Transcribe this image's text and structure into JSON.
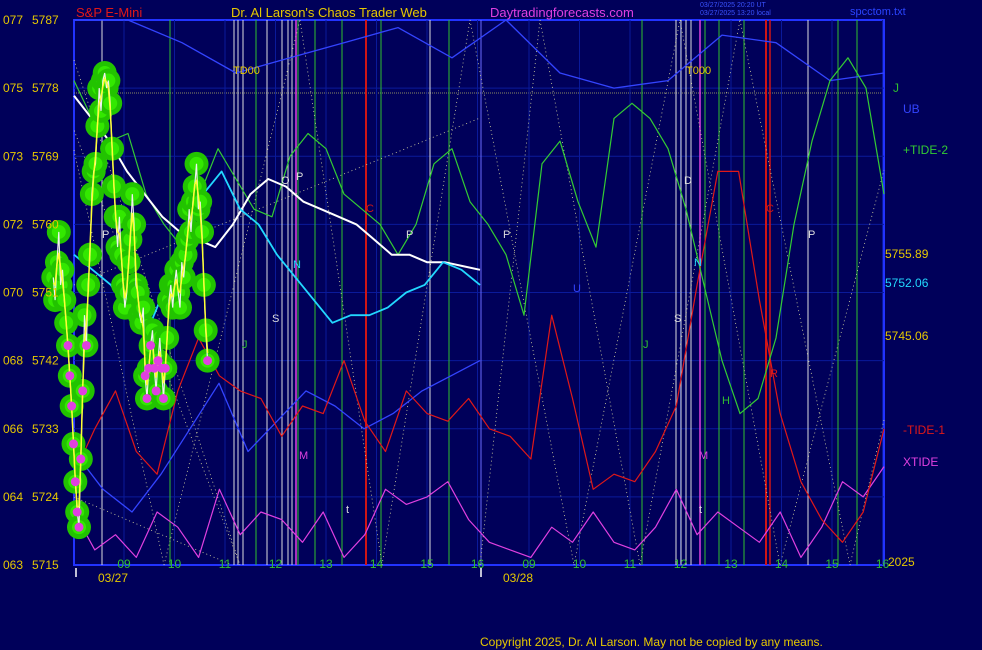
{
  "header": {
    "instrument": "S&P E-Mini",
    "author": "Dr. Al Larson's Chaos Trader Web",
    "site": "Daytradingforecasts.com",
    "time_line_1": "03/27/2025 20:20 UT",
    "time_line_2": "03/27/2025 13:20 local",
    "file": "spcctom.txt"
  },
  "footer": {
    "copyright": "Copyright 2025, Dr. Al Larson. May not be copied by any means."
  },
  "colors": {
    "background": "#00005a",
    "frame": "#2233ff",
    "grid": "#0a1a9a",
    "price": "#f0f0f0",
    "label_gold": "#e6c800",
    "tide2": "#33cc33",
    "tide1": "#e01818",
    "xtide": "#e040e0",
    "band": "#3344ff",
    "white_ma": "#ffffff",
    "cyan_ma": "#22d8ff",
    "yellow_ma": "#ffff33",
    "halo": "#22c300",
    "red_line": "#d01515",
    "green_line": "#2fbf2f",
    "gray_line": "#dddddd"
  },
  "chart_data": {
    "type": "line",
    "title": "S&P E-Mini",
    "y_left_codes": [
      "077",
      "075",
      "073",
      "072",
      "070",
      "068",
      "066",
      "064",
      "063"
    ],
    "y_left_prices": [
      "5787",
      "5778",
      "5769",
      "5760",
      "5751",
      "5742",
      "5733",
      "5724",
      "5715"
    ],
    "ylim": [
      5715,
      5787
    ],
    "x_hour_labels": [
      "09",
      "10",
      "11",
      "12",
      "13",
      "14",
      "15",
      "16",
      "09",
      "10",
      "11",
      "12",
      "13",
      "14",
      "15",
      "16"
    ],
    "date_labels": [
      "03/27",
      "03/28"
    ],
    "year_label": "2025",
    "x": [
      0,
      0.0364,
      0.0727,
      0.109,
      0.145,
      0.182,
      0.218,
      0.255,
      0.291,
      0.327,
      0.364,
      0.4,
      0.436,
      0.473,
      0.509,
      0.545,
      0.582,
      0.618,
      0.655,
      0.691,
      0.727,
      0.764,
      0.8,
      0.836,
      0.873,
      0.909,
      0.945,
      0.982,
      1.018,
      1.055,
      1.091,
      1.127,
      1.164,
      1.2,
      1.236,
      1.273,
      1.309,
      1.345,
      1.382,
      1.418,
      1.455,
      1.491,
      1.527,
      1.564,
      1.6,
      1.636,
      1.673,
      1.709,
      1.745,
      1.782,
      1.818,
      1.855,
      1.891,
      1.927,
      1.964,
      2,
      2.036,
      2.073,
      2.109,
      2.145,
      2.182,
      2.218,
      2.255,
      2.291,
      2.327,
      2.364,
      2.4,
      2.436,
      2.473,
      2.509,
      2.545,
      2.582,
      2.618,
      2.655,
      2.691,
      2.727,
      2.764,
      2.8,
      2.836,
      2.873,
      2.909,
      2.945,
      2.982,
      3.018,
      3.055,
      3.091,
      3.127,
      3.164,
      3.2,
      3.236,
      3.273,
      3.309,
      3.345,
      3.382,
      3.418,
      3.455,
      3.491,
      3.527,
      3.564,
      3.6,
      3.636,
      3.673,
      3.709,
      3.745,
      3.782,
      3.818,
      3.855,
      3.891,
      3.927,
      3.964,
      4,
      4.036,
      4.073,
      4.109,
      4.145,
      4.182,
      4.218,
      4.255,
      4.291,
      4.327,
      4.364,
      4.4,
      4.436,
      4.473,
      4.509,
      4.545,
      4.582,
      4.618,
      4.655,
      4.691,
      4.727,
      4.764,
      4.8,
      4.836,
      4.873,
      4.909,
      4.945,
      4.982,
      5.018,
      5.055,
      5.091,
      5.127,
      5.164,
      5.2,
      5.236,
      5.273,
      5.309,
      5.345,
      5.382,
      5.418,
      5.455,
      5.491,
      5.527,
      5.564,
      5.6,
      5.636,
      5.673,
      5.709,
      5.745,
      5.782,
      5.818,
      5.855,
      5.891,
      5.927,
      5.964,
      6,
      6.036,
      6.073,
      6.109,
      6.145,
      6.182,
      6.218,
      6.255,
      6.291,
      6.327,
      6.364,
      6.4,
      6.436,
      6.473,
      6.509,
      6.545,
      6.582,
      6.618,
      6.655,
      6.691,
      6.727,
      6.764,
      6.8,
      6.836,
      6.873,
      6.909,
      6.945,
      6.982,
      7.018,
      7.055,
      7.091,
      7.127
    ],
    "series": [
      {
        "name": "price",
        "values": [
          5753,
          5750,
          5755,
          5759,
          5752,
          5754,
          5750,
          5747,
          5744,
          5740,
          5736,
          5731,
          5726,
          5722,
          5720,
          5729,
          5738,
          5748,
          5744,
          5752,
          5756,
          5764,
          5767,
          5768,
          5773,
          5778,
          5775,
          5779,
          5780,
          5778,
          5779,
          5776,
          5770,
          5765,
          5761,
          5757,
          5761,
          5756,
          5752,
          5749,
          5751,
          5755,
          5758,
          5764,
          5760,
          5752,
          5751,
          5748,
          5747,
          5749,
          5740,
          5737,
          5741,
          5744,
          5746,
          5741,
          5738,
          5742,
          5745,
          5741,
          5737,
          5741,
          5745,
          5750,
          5752,
          5749,
          5752,
          5754,
          5751,
          5749,
          5755,
          5753,
          5756,
          5758,
          5762,
          5759,
          5763,
          5765,
          5768,
          5762,
          5763,
          5759,
          5752,
          5746,
          5742
        ]
      },
      {
        "name": "white MA",
        "values": [
          5777,
          5774,
          5771,
          5767,
          5764,
          5761,
          5759,
          5758,
          5757,
          5760,
          5764,
          5766,
          5765,
          5763,
          5762,
          5761,
          5760,
          5758,
          5756,
          5756,
          5755,
          5755,
          5754.5,
          5754
        ]
      },
      {
        "name": "cyan MA",
        "values": [
          5756,
          5754,
          5752,
          5748,
          5746,
          5752,
          5757,
          5764,
          5767,
          5762,
          5760,
          5756,
          5753,
          5750,
          5747,
          5748,
          5748,
          5749,
          5751,
          5752,
          5755,
          5754,
          5752
        ]
      },
      {
        "name": "+TIDE-2",
        "values": [
          5779,
          5774,
          5771,
          5772,
          5764,
          5760,
          5757,
          5764,
          5770,
          5766,
          5762,
          5761,
          5769,
          5772,
          5770,
          5764,
          5762,
          5760,
          5756,
          5760,
          5768,
          5770,
          5763,
          5760,
          5756,
          5748,
          5768,
          5771,
          5763,
          5757,
          5774,
          5776,
          5774,
          5770,
          5762,
          5752,
          5742,
          5735,
          5737,
          5745,
          5760,
          5771,
          5779,
          5782,
          5778,
          5764
        ]
      },
      {
        "name": "-TIDE-1",
        "values": [
          5727,
          5733,
          5738,
          5730,
          5727,
          5738,
          5745,
          5740,
          5738,
          5737,
          5732,
          5736,
          5735,
          5742,
          5734,
          5730,
          5738,
          5735,
          5734,
          5737,
          5733,
          5732,
          5729,
          5748,
          5737,
          5725,
          5727,
          5726,
          5730,
          5736,
          5752,
          5767,
          5767,
          5750,
          5735,
          5726,
          5721,
          5718,
          5722,
          5733
        ]
      },
      {
        "name": "XTIDE",
        "values": [
          5722,
          5717,
          5719,
          5716,
          5722,
          5720,
          5716,
          5725,
          5719,
          5722,
          5721,
          5718,
          5722,
          5716,
          5719,
          5725,
          5723,
          5724,
          5726,
          5721,
          5718,
          5717,
          5716,
          5720,
          5718,
          5722,
          5718,
          5717,
          5720,
          5725,
          5719,
          5722,
          5720,
          5718,
          5722,
          5716,
          5720,
          5726,
          5724,
          5728
        ]
      },
      {
        "name": "UB",
        "values": [
          5787,
          5787,
          5784,
          5780,
          5782,
          5784,
          5786,
          5782,
          5787,
          5780,
          5778,
          5779,
          5785,
          5784,
          5779,
          5780
        ]
      },
      {
        "name": "LB",
        "values": [
          5730,
          5725,
          5722,
          5727,
          5733,
          5739,
          5730,
          5734,
          5738,
          5736,
          5733,
          5735,
          5738,
          5740,
          5742
        ]
      }
    ],
    "right_labels": [
      "J",
      "UB",
      "+TIDE-2",
      "5755.89",
      "5752.06",
      "5745.06",
      "-TIDE-1",
      "XTIDE"
    ],
    "marker_letters": [
      "TD00",
      "T000",
      "P",
      "P",
      "P",
      "P",
      "P",
      "O",
      "D",
      "C",
      "C",
      "S",
      "S",
      "J",
      "J",
      "N",
      "N",
      "M",
      "M",
      "U",
      "H",
      "R",
      "t",
      "t"
    ]
  }
}
